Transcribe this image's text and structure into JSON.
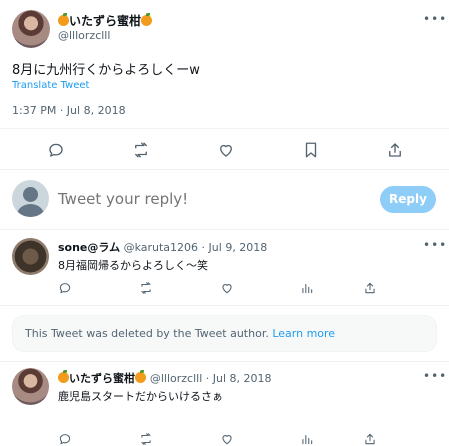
{
  "main_tweet": {
    "name": "いたずら蜜柑",
    "handle": "@lllorzclll",
    "text": "8月に九州行くからよろしくーw",
    "translate_label": "Translate Tweet",
    "timestamp": "1:37 PM · Jul 8, 2018"
  },
  "reply_composer": {
    "placeholder": "Tweet your reply!",
    "button_label": "Reply"
  },
  "replies": [
    {
      "name": "sone@ラム",
      "handle": "@karuta1206",
      "date": "Jul 9, 2018",
      "text": "8月福岡帰るからよろしく～笑"
    },
    {
      "name": "いたずら蜜柑",
      "handle": "@lllorzclll",
      "date": "Jul 8, 2018",
      "text": "鹿児島スタートだからいけるさぁ"
    }
  ],
  "deleted_notice": {
    "text": "This Tweet was deleted by the Tweet author.",
    "link": "Learn more"
  },
  "colors": {
    "accent": "#1d9bf0",
    "reply_button": "#8ecdf8",
    "muted_text": "#536471",
    "divider": "#eff3f4"
  },
  "icons": [
    "reply-icon",
    "retweet-icon",
    "like-icon",
    "bookmark-icon",
    "share-icon",
    "views-icon",
    "more-icon",
    "orange-emoji"
  ]
}
